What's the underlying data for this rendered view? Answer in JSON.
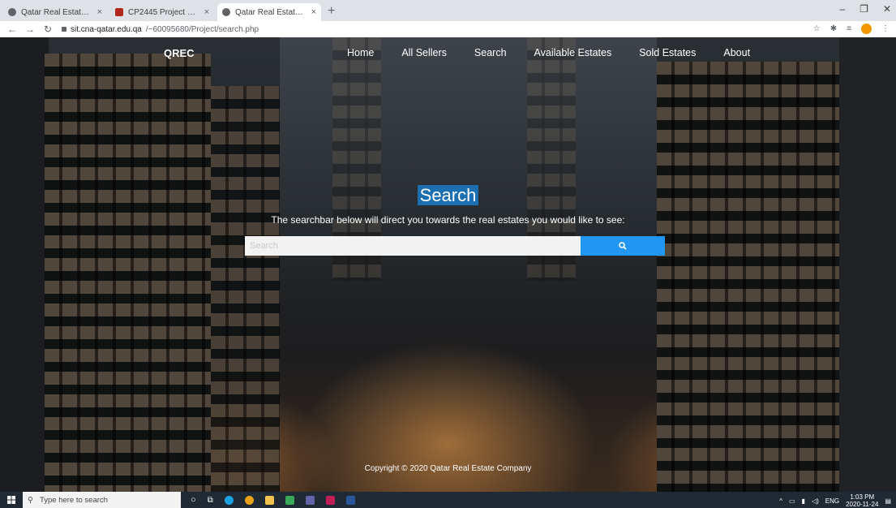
{
  "browser": {
    "tabs": [
      {
        "title": "Qatar Real Estate Company",
        "favicon": "globe-icon"
      },
      {
        "title": "CP2445 Project Fall 2020 - CP2445",
        "favicon": "project-icon"
      },
      {
        "title": "Qatar Real Estate Company",
        "favicon": "globe-icon",
        "active": true
      }
    ],
    "new_tab": "+",
    "address": {
      "host": "sit.cna-qatar.edu.qa",
      "path": "/~60095680/Project/search.php"
    }
  },
  "site": {
    "brand": "QREC",
    "nav": [
      "Home",
      "All Sellers",
      "Search",
      "Available Estates",
      "Sold Estates",
      "About"
    ],
    "heading": "Search",
    "subtitle": "The searchbar below will direct you towards the real estates you would like to see:",
    "search": {
      "placeholder": "Search",
      "value": "",
      "button_icon": "search-icon"
    },
    "footer": "Copyright © 2020 Qatar Real Estate Company"
  },
  "taskbar": {
    "search_placeholder": "Type here to search",
    "tray": {
      "language": "ENG",
      "time": "1:03 PM",
      "date": "2020-11-24"
    }
  },
  "colors": {
    "accent": "#2196f3",
    "heading_bg": "#1c6fb0"
  }
}
